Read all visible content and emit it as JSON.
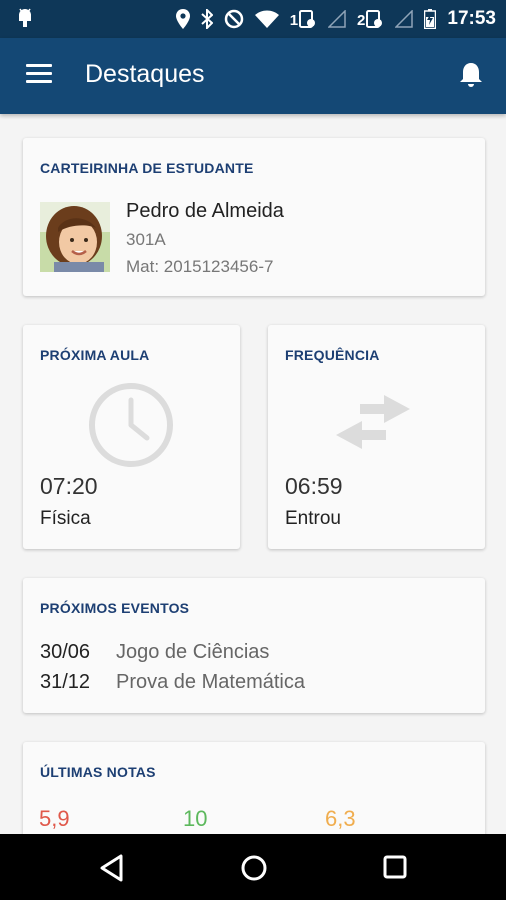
{
  "status_bar": {
    "time": "17:53",
    "sim1": "1",
    "sim2": "2"
  },
  "app_bar": {
    "title": "Destaques",
    "menu_icon": "hamburger-menu-icon",
    "notification_icon": "bell-icon"
  },
  "student_card": {
    "title": "CARTEIRINHA DE ESTUDANTE",
    "name": "Pedro de Almeida",
    "class": "301A",
    "registration": "Mat: 2015123456-7"
  },
  "next_class": {
    "title": "PRÓXIMA AULA",
    "time": "07:20",
    "subject": "Física",
    "icon": "clock-icon"
  },
  "frequency": {
    "title": "FREQUÊNCIA",
    "time": "06:59",
    "status": "Entrou",
    "icon": "swap-arrows-icon"
  },
  "events": {
    "title": "PRÓXIMOS EVENTOS",
    "items": [
      {
        "date": "30/06",
        "name": "Jogo de Ciências"
      },
      {
        "date": "31/12",
        "name": "Prova de Matemática"
      }
    ]
  },
  "grades": {
    "title": "ÚLTIMAS NOTAS",
    "items": [
      {
        "value": "5,9",
        "color": "#e0584a"
      },
      {
        "value": "10",
        "color": "#5cb85c"
      },
      {
        "value": "6,3",
        "color": "#f0ad4e"
      }
    ]
  },
  "colors": {
    "status_bar": "#0e3758",
    "app_bar": "#144875",
    "card_title": "#1d3f73"
  }
}
